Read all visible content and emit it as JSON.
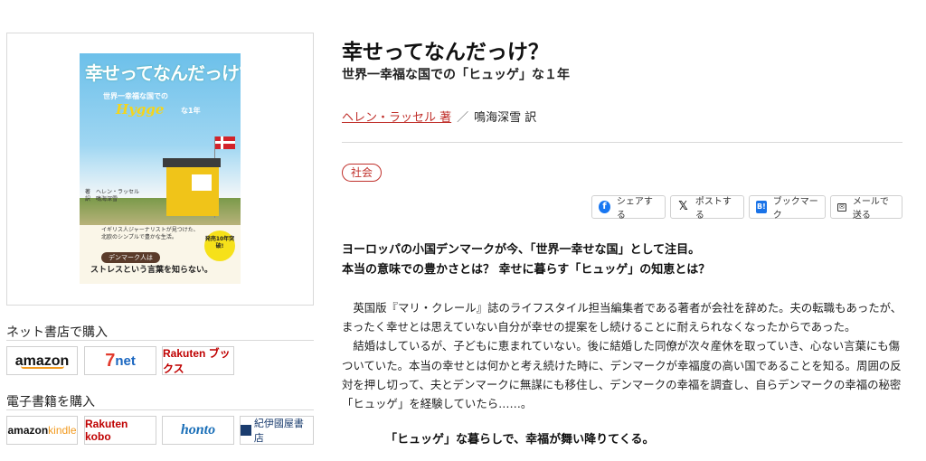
{
  "cover": {
    "title": "幸せってなんだっけ?",
    "subtitle": "世界一幸福な国での",
    "hygge": "Hygge",
    "hygge_tail": "な1年",
    "author_line1": "著　ヘレン・ラッセル",
    "author_line2": "訳　鳴海深雪",
    "blurb_line1": "イギリス人ジャーナリストが見つけた、",
    "blurb_line2": "北欧のシンプルで豊かな生活。",
    "badge": "発売10年突破!",
    "pill": "デンマーク人は",
    "big": "ストレスという言葉を知らない。"
  },
  "stores": {
    "print_title": "ネット書店で購入",
    "ebook_title": "電子書籍を購入",
    "amazon": "amazon",
    "sevennet_7": "7",
    "sevennet": "net",
    "rakuten": "Rakuten ブックス",
    "kindle_a": "amazon",
    "kindle_b": "kindle",
    "kobo": "Rakuten kobo",
    "honto": "honto",
    "kinokuniya": "紀伊國屋書店"
  },
  "book": {
    "title": "幸せってなんだっけ？",
    "subtitle": "世界一幸福な国での「ヒュッゲ」な１年",
    "author": "ヘレン・ラッセル 著",
    "separator": "／",
    "translator": "鳴海深雪 訳",
    "tag": "社会"
  },
  "share": {
    "facebook": "シェアする",
    "x": "ポストする",
    "bookmark": "ブックマーク",
    "mail": "メールで送る"
  },
  "description": {
    "lead1": "ヨーロッパの小国デンマークが今、「世界一幸せな国」として注目。",
    "lead2": "本当の意味での豊かさとは？ 幸せに暮らす「ヒュッゲ」の知恵とは？",
    "para1": "英国版『マリ・クレール』誌のライフスタイル担当編集者である著者が会社を辞めた。夫の転職もあったが、まったく幸せとは思えていない自分が幸せの提案をし続けることに耐えられなくなったからであった。",
    "para2": "結婚はしているが、子どもに恵まれていない。後に結婚した同僚が次々産休を取っていき、心ない言葉にも傷ついていた。本当の幸せとは何かと考え続けた時に、デンマークが幸福度の高い国であることを知る。周囲の反対を押し切って、夫とデンマークに無謀にも移住し、デンマークの幸福を調査し、自らデンマークの幸福の秘密「ヒュッゲ」を経験していたら……。",
    "closing": "「ヒュッゲ」な暮らしで、幸福が舞い降りてくる。"
  }
}
